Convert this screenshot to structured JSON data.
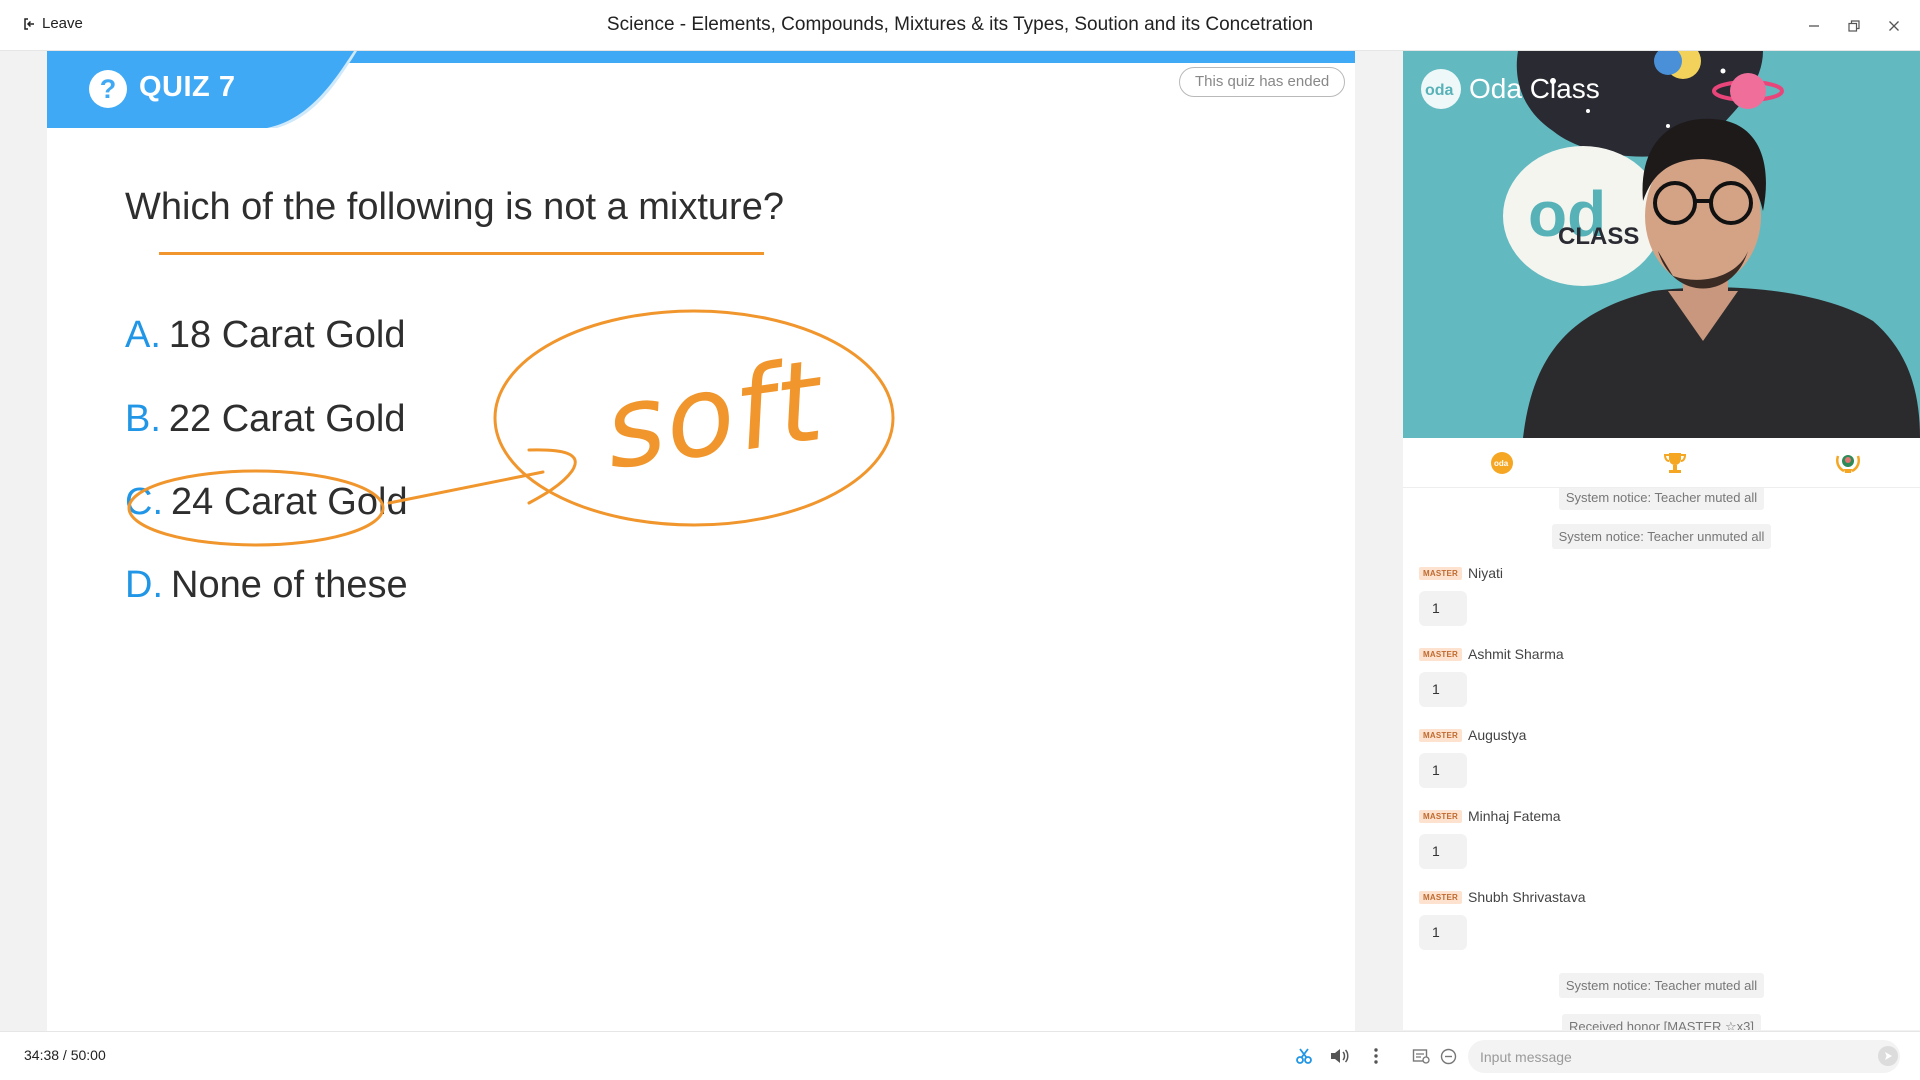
{
  "titlebar": {
    "leave_label": "Leave",
    "title": "Science - Elements, Compounds, Mixtures & its Types, Soution and its Concetration"
  },
  "quiz": {
    "label": "QUIZ 7",
    "status": "This quiz has ended",
    "question": "Which of the following is not a mixture?",
    "options": [
      {
        "letter": "A.",
        "text": "18 Carat Gold"
      },
      {
        "letter": "B.",
        "text": "22 Carat Gold"
      },
      {
        "letter": "C.",
        "text": "24 Carat Gold"
      },
      {
        "letter": "D.",
        "text": "None of these"
      }
    ],
    "annotation": "soft",
    "accent_color": "#3fa9f5",
    "ink_color": "#f0962c"
  },
  "video": {
    "brand_text": "Oda Class",
    "backdrop_text_top": "od",
    "backdrop_text_bottom": "CLASS"
  },
  "chat": {
    "messages": [
      {
        "type": "notice",
        "text": "System notice: Teacher muted all"
      },
      {
        "type": "notice",
        "text": "System notice: Teacher unmuted all"
      },
      {
        "type": "msg",
        "badge": "MASTER",
        "name": "Niyati",
        "text": "1"
      },
      {
        "type": "msg",
        "badge": "MASTER",
        "name": "Ashmit Sharma",
        "text": "1"
      },
      {
        "type": "msg",
        "badge": "MASTER",
        "name": "Augustya",
        "text": "1"
      },
      {
        "type": "msg",
        "badge": "MASTER",
        "name": "Minhaj Fatema",
        "text": "1"
      },
      {
        "type": "msg",
        "badge": "MASTER",
        "name": "Shubh Shrivastava",
        "text": "1"
      },
      {
        "type": "notice",
        "text": "System notice: Teacher muted all"
      },
      {
        "type": "notice",
        "text": "Received honor [MASTER ☆x3]"
      }
    ],
    "input_placeholder": "Input message"
  },
  "bottombar": {
    "elapsed": "34:38",
    "total": "50:00"
  }
}
